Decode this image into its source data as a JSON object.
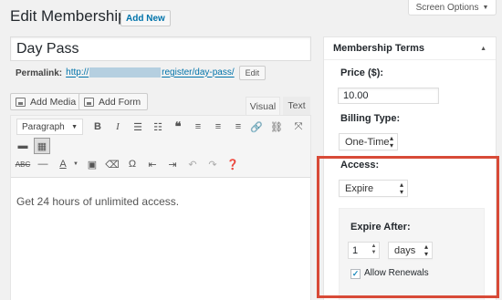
{
  "header": {
    "title": "Edit Membership",
    "add_new": "Add New",
    "screen_options": "Screen Options"
  },
  "post": {
    "title_value": "Day Pass",
    "permalink_label": "Permalink:",
    "permalink_prefix": "http://",
    "permalink_suffix": "register/day-pass/",
    "edit_label": "Edit"
  },
  "editor": {
    "add_media": "Add Media",
    "add_form": "Add Form",
    "tab_visual": "Visual",
    "tab_text": "Text",
    "format_select": "Paragraph",
    "content": "Get 24 hours of unlimited access."
  },
  "terms": {
    "title": "Membership Terms",
    "price_label": "Price ($):",
    "price_value": "10.00",
    "billing_label": "Billing Type:",
    "billing_value": "One-Time",
    "access_label": "Access:",
    "access_value": "Expire",
    "expire_after_label": "Expire After:",
    "expire_number": "1",
    "expire_unit": "days",
    "allow_renewals_label": "Allow Renewals",
    "allow_renewals_checked": true
  },
  "colors": {
    "link": "#0073aa",
    "highlight": "#d84a37",
    "page_bg": "#f1f1f1"
  }
}
